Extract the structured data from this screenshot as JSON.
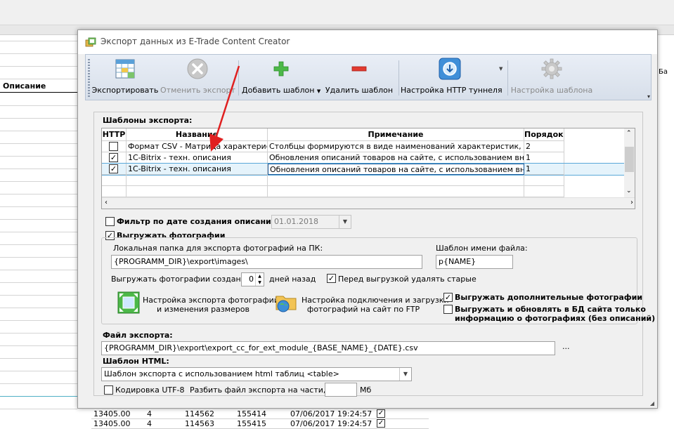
{
  "background": {
    "column_header": "Описание",
    "rows": [
      {
        "c1": "13405.00",
        "c2": "4",
        "c3": "114562",
        "c4": "155414",
        "c5": "07/06/2017 19:24:57"
      },
      {
        "c1": "13405.00",
        "c2": "4",
        "c3": "114563",
        "c4": "155415",
        "c5": "07/06/2017 19:24:57"
      }
    ],
    "right_text": "Ба"
  },
  "dialog": {
    "title": "Экспорт данных из E-Trade Content Creator"
  },
  "toolbar": {
    "export": "Экспортировать",
    "cancel_export": "Отменить экспорт",
    "add_template": "Добавить шаблон",
    "delete_template": "Удалить шаблон",
    "http_tunnel": "Настройка HTTP туннеля",
    "template_settings": "Настройка шаблона"
  },
  "templates": {
    "section_label": "Шаблоны экспорта:",
    "columns": [
      "HTTP",
      "Название",
      "Примечание",
      "Порядок"
    ],
    "rows": [
      {
        "http": false,
        "name": "Формат CSV - Матрица характеристик",
        "note": "Столбцы формируются в виде наименований характеристик, строки",
        "order": "2"
      },
      {
        "http": true,
        "name": "1C-Bitrix - техн. описания",
        "note": "Обновления описаний товаров на сайте, с использованием внешнего",
        "order": "1"
      },
      {
        "http": true,
        "name": "1C-Bitrix - техн. описания",
        "note": "Обновления описаний товаров на сайте, с использованием внешнего",
        "order": "1"
      }
    ]
  },
  "filter": {
    "label": "Фильтр по дате создания описаний",
    "date": "01.01.2018"
  },
  "photos": {
    "label": "Выгружать фотографии",
    "folder_label": "Локальная папка для экспорта фотографий на ПК:",
    "folder_value": "{PROGRAMM_DIR}\\export\\images\\",
    "filename_label": "Шаблон имени файла:",
    "filename_value": "p{NAME}",
    "created_label": "Выгружать фотографии созданные",
    "created_value": "0",
    "days_label": "дней назад",
    "delete_old_label": "Перед выгрузкой удалять старые",
    "resize_label_1": "Настройка экспорта фотографий",
    "resize_label_2": "и изменения размеров",
    "ftp_label_1": "Настройка подключения и загрузки",
    "ftp_label_2": "фотографий на сайт по FTP",
    "extra_photos_label": "Выгружать дополнительные фотографии",
    "update_only_label_1": "Выгружать и обновлять в БД сайта только",
    "update_only_label_2": "информацию о фотографиях (без описаний)"
  },
  "export_file": {
    "label": "Файл экспорта:",
    "value": "{PROGRAMM_DIR}\\export\\export_cc_for_ext_module_{BASE_NAME}_{DATE}.csv",
    "browse": "..."
  },
  "html_template": {
    "label": "Шаблон HTML:",
    "value": "Шаблон экспорта с использованием html таблиц <table>"
  },
  "encoding": {
    "utf8_label": "Кодировка UTF-8",
    "split_label": "Разбить файл экспорта на части, по:",
    "split_value": "",
    "unit": "Мб"
  },
  "colors": {
    "selected_row": "#e5f3fb",
    "arrow": "#e02020",
    "toolbar": "#dfe6f0"
  }
}
